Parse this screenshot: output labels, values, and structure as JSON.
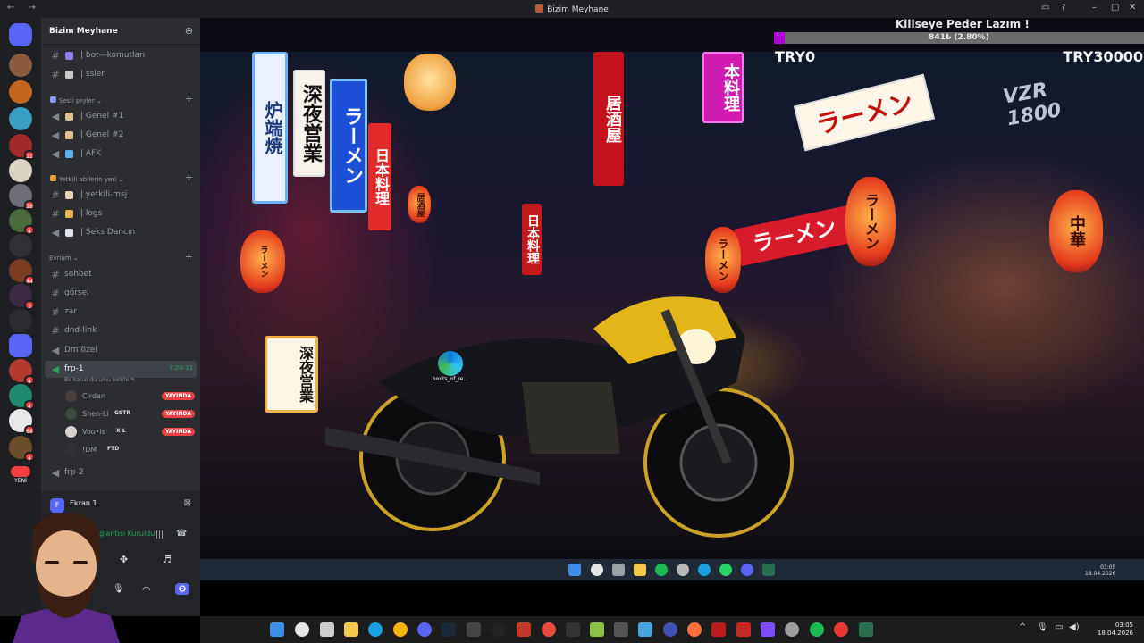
{
  "window": {
    "title": "Bizim Meyhane",
    "nav": "← →"
  },
  "server": {
    "name": "Bizim Meyhane"
  },
  "servers": [
    {
      "badge": ""
    },
    {
      "badge": ""
    },
    {
      "badge": ""
    },
    {
      "badge": "21"
    },
    {
      "badge": ""
    },
    {
      "badge": "28"
    },
    {
      "badge": "4"
    },
    {
      "badge": ""
    },
    {
      "badge": "44"
    },
    {
      "badge": "3"
    },
    {
      "badge": ""
    },
    {
      "badge": "4"
    },
    {
      "badge": "4"
    },
    {
      "badge": "68"
    },
    {
      "badge": "4"
    }
  ],
  "new_label": "YENİ",
  "channels": {
    "bot": "| bot—komutları",
    "ssler": "| ssler",
    "cat_voice": "Sesli şeyler ⌄",
    "genel1": "| Genel #1",
    "genel2": "| Genel #2",
    "afk": "| AFK",
    "cat_admin": "Yetkili abilerin yeri ⌄",
    "yetkili": "| yetkili-msj",
    "logs": "| logs",
    "seks": "| Seks Dancın",
    "cat_evrim": "Evrium ⌄",
    "sohbet": "sohbet",
    "gorsel": "görsel",
    "zar": "zar",
    "dnd": "dnd-link",
    "dm": "Dm özel",
    "frp1": "frp-1",
    "frp1_time": "7:24:13",
    "frp1_status": "Bir kanal durumu belirle ✎",
    "frp2": "frp-2"
  },
  "voice_users": [
    {
      "name": "Cirdan",
      "tag": "",
      "live": "YAYINDA"
    },
    {
      "name": "Shen-Li",
      "tag": "GSTR",
      "live": "YAYINDA"
    },
    {
      "name": "Voo•is",
      "tag": "X L",
      "live": "YAYINDA"
    },
    {
      "name": "!DM",
      "tag": "FTD",
      "live": ""
    }
  ],
  "panel": {
    "stream_title": "Ekran 1",
    "stream_initial": "F",
    "voice_status": "Ses Bağlantısı Kuruldu"
  },
  "overlay": {
    "title": "Kiliseye Peder Lazım !",
    "progress_text": "841₺ (2.80%)",
    "progress_fraction": 0.028,
    "min": "TRY0",
    "max": "TRY30000",
    "fill_color": "#b000d6"
  },
  "desktop": {
    "icon_label": "boots_of_re..."
  },
  "inner_clock": {
    "time": "03:05",
    "date": "18.04.2026"
  },
  "clock": {
    "time": "03:05",
    "date": "18.04.2026"
  },
  "signs": {
    "s1": "深夜営業",
    "s2": "ラーメン",
    "s3": "日本料理",
    "s4": "居酒屋",
    "s5": "本料理",
    "s6": "ラーメン",
    "s7": "中華",
    "s8": "深夜営業",
    "s9": "居酒屋",
    "s10": "炉端焼",
    "s11": "VZR 1800"
  }
}
